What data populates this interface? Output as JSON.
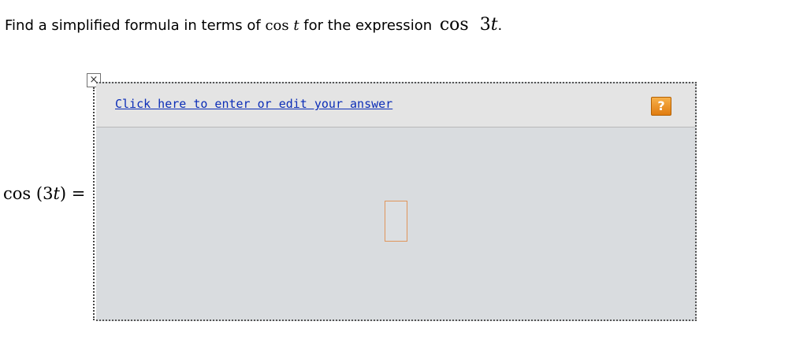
{
  "question": {
    "text_before": "Find a simplified formula in terms of ",
    "math_1_func": "cos",
    "math_1_var": "t",
    "text_middle": " for the expression ",
    "math_2_func": "cos",
    "math_2_arg": "3",
    "math_2_var": "t",
    "period": "."
  },
  "equation": {
    "lhs_func": "cos",
    "lhs_open": "(3",
    "lhs_var": "t",
    "lhs_close": ")",
    "equals": "="
  },
  "editor": {
    "close_glyph": "×",
    "link_text": "Click here to enter or edit your answer",
    "help_glyph": "?",
    "answer_value": ""
  },
  "colors": {
    "link": "#0b2db7",
    "help_button": "#f0921f",
    "answer_slot_border": "#e0955b",
    "editor_background": "#d9dcdf"
  }
}
